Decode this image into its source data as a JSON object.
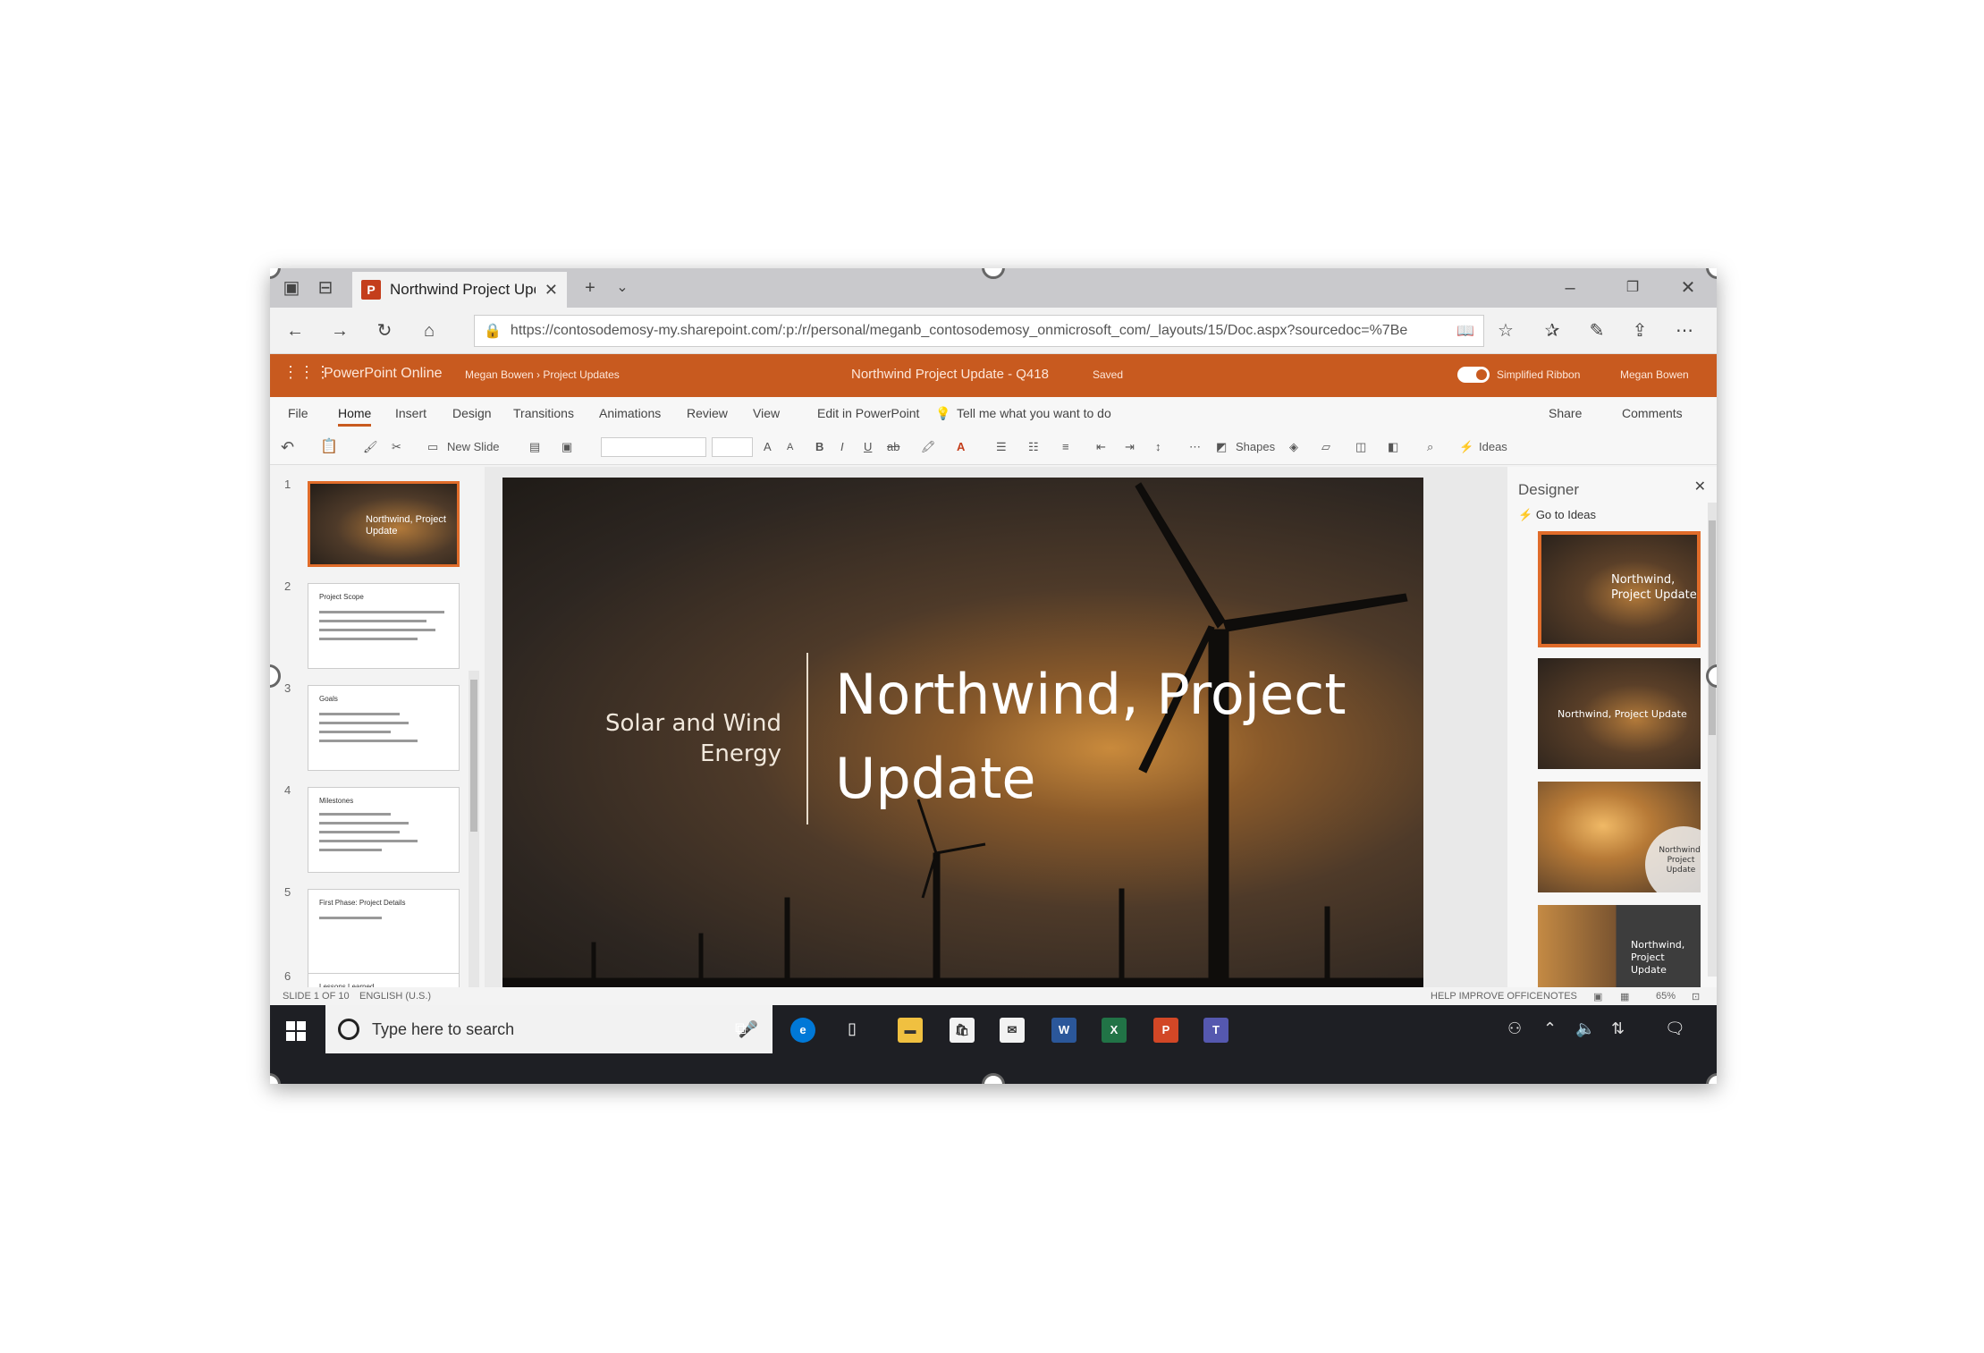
{
  "browser": {
    "tab_title": "Northwind Project Upda",
    "url": "https://contosodemosy-my.sharepoint.com/:p:/r/personal/meganb_contosodemosy_onmicrosoft_com/_layouts/15/Doc.aspx?sourcedoc=%7Be"
  },
  "app": {
    "name": "PowerPoint Online",
    "breadcrumb": "Megan Bowen › Project Updates",
    "doc_title": "Northwind Project Update - Q418",
    "saved_status": "Saved",
    "simplified_ribbon_label": "Simplified Ribbon",
    "user": "Megan Bowen"
  },
  "menu": {
    "items": [
      "File",
      "Home",
      "Insert",
      "Design",
      "Transitions",
      "Animations",
      "Review",
      "View"
    ],
    "active": "Home",
    "edit_in_app": "Edit in PowerPoint",
    "tell_me": "Tell me what you want to do",
    "share": "Share",
    "comments": "Comments"
  },
  "ribbon": {
    "new_slide": "New Slide",
    "shapes": "Shapes",
    "ideas": "Ideas"
  },
  "thumbnails": [
    {
      "num": "1",
      "title": "Northwind, Project Update"
    },
    {
      "num": "2",
      "title": "Project Scope"
    },
    {
      "num": "3",
      "title": "Goals"
    },
    {
      "num": "4",
      "title": "Milestones"
    },
    {
      "num": "5",
      "title": "First Phase: Project Details"
    },
    {
      "num": "6",
      "title": "Lessons Learned"
    }
  ],
  "slide": {
    "subtitle": "Solar and Wind Energy",
    "title": "Northwind, Project Update"
  },
  "designer": {
    "title": "Designer",
    "go_to_ideas": "Go to Ideas",
    "options": [
      "Northwind, Project Update",
      "Northwind, Project Update",
      "Northwind, Project Update",
      "Northwind, Project Update"
    ]
  },
  "status": {
    "slide_count": "SLIDE 1 OF 10",
    "language": "ENGLISH (U.S.)",
    "help_improve": "HELP IMPROVE OFFICE",
    "notes": "NOTES",
    "zoom": "65%"
  },
  "taskbar": {
    "search_placeholder": "Type here to search"
  },
  "colors": {
    "accent": "#c85a1f",
    "taskbar": "#1e1f24"
  }
}
